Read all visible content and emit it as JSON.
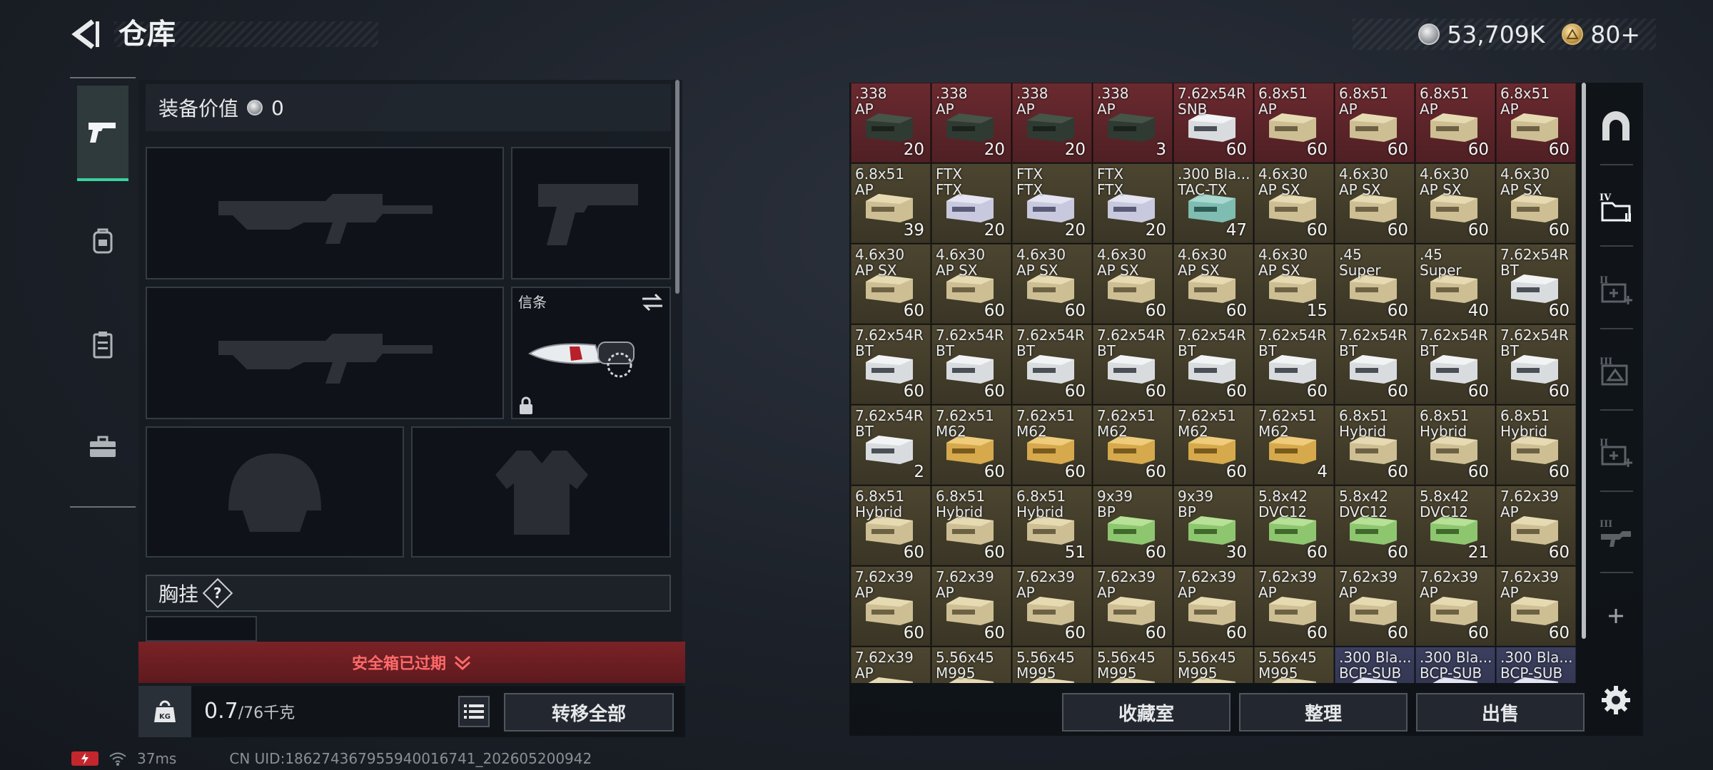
{
  "header": {
    "title": "仓库",
    "currency": [
      {
        "icon": "silver-coin-icon",
        "value": "53,709K"
      },
      {
        "icon": "gold-coin-icon",
        "value": "80+"
      }
    ]
  },
  "left_tabs": [
    {
      "icon": "pistol-icon",
      "active": true
    },
    {
      "icon": "backpack-icon",
      "active": false
    },
    {
      "icon": "clipboard-icon",
      "active": false
    },
    {
      "icon": "briefcase-icon",
      "active": false
    }
  ],
  "loadout": {
    "equip_value_label": "装备价值",
    "equip_value": "0",
    "melee_label": "信条",
    "chest_label": "胸挂",
    "help_mark": "?",
    "safebox_expired": "安全箱已过期",
    "weight_current": "0.7",
    "weight_max": "/76千克",
    "weight_icon_text": "KG",
    "transfer_all": "转移全部"
  },
  "status": {
    "ping": "37ms",
    "uid": "CN UID:1862743679559400167​41_202605200942"
  },
  "storage": {
    "items": [
      {
        "name": ".338\nAP",
        "count": "20",
        "bg": "red",
        "box": "dark"
      },
      {
        "name": ".338\nAP",
        "count": "20",
        "bg": "red",
        "box": "dark"
      },
      {
        "name": ".338\nAP",
        "count": "20",
        "bg": "red",
        "box": "dark"
      },
      {
        "name": ".338\nAP",
        "count": "3",
        "bg": "red",
        "box": "dark"
      },
      {
        "name": "7.62x54R\nSNB",
        "count": "60",
        "bg": "red",
        "box": "white"
      },
      {
        "name": "6.8x51\nAP",
        "count": "60",
        "bg": "red",
        "box": "tan"
      },
      {
        "name": "6.8x51\nAP",
        "count": "60",
        "bg": "red",
        "box": "tan"
      },
      {
        "name": "6.8x51\nAP",
        "count": "60",
        "bg": "red",
        "box": "tan"
      },
      {
        "name": "6.8x51\nAP",
        "count": "60",
        "bg": "red",
        "box": "tan"
      },
      {
        "name": "6.8x51\nAP",
        "count": "39",
        "bg": "olive",
        "box": "tan"
      },
      {
        "name": "FTX\nFTX",
        "count": "20",
        "bg": "olive",
        "box": "lavender"
      },
      {
        "name": "FTX\nFTX",
        "count": "20",
        "bg": "olive",
        "box": "lavender"
      },
      {
        "name": "FTX\nFTX",
        "count": "20",
        "bg": "olive",
        "box": "lavender"
      },
      {
        "name": ".300 Bla...\nTAC-TX",
        "count": "47",
        "bg": "olive",
        "box": "teal"
      },
      {
        "name": "4.6x30\nAP SX",
        "count": "60",
        "bg": "olive",
        "box": "tan"
      },
      {
        "name": "4.6x30\nAP SX",
        "count": "60",
        "bg": "olive",
        "box": "tan"
      },
      {
        "name": "4.6x30\nAP SX",
        "count": "60",
        "bg": "olive",
        "box": "tan"
      },
      {
        "name": "4.6x30\nAP SX",
        "count": "60",
        "bg": "olive",
        "box": "tan"
      },
      {
        "name": "4.6x30\nAP SX",
        "count": "60",
        "bg": "olive",
        "box": "tan"
      },
      {
        "name": "4.6x30\nAP SX",
        "count": "60",
        "bg": "olive",
        "box": "tan"
      },
      {
        "name": "4.6x30\nAP SX",
        "count": "60",
        "bg": "olive",
        "box": "tan"
      },
      {
        "name": "4.6x30\nAP SX",
        "count": "60",
        "bg": "olive",
        "box": "tan"
      },
      {
        "name": "4.6x30\nAP SX",
        "count": "60",
        "bg": "olive",
        "box": "tan"
      },
      {
        "name": "4.6x30\nAP SX",
        "count": "15",
        "bg": "olive",
        "box": "tan"
      },
      {
        "name": ".45\nSuper",
        "count": "60",
        "bg": "olive",
        "box": "tan"
      },
      {
        "name": ".45\nSuper",
        "count": "40",
        "bg": "olive",
        "box": "tan"
      },
      {
        "name": "7.62x54R\nBT",
        "count": "60",
        "bg": "olive",
        "box": "white"
      },
      {
        "name": "7.62x54R\nBT",
        "count": "60",
        "bg": "olive",
        "box": "white"
      },
      {
        "name": "7.62x54R\nBT",
        "count": "60",
        "bg": "olive",
        "box": "white"
      },
      {
        "name": "7.62x54R\nBT",
        "count": "60",
        "bg": "olive",
        "box": "white"
      },
      {
        "name": "7.62x54R\nBT",
        "count": "60",
        "bg": "olive",
        "box": "white"
      },
      {
        "name": "7.62x54R\nBT",
        "count": "60",
        "bg": "olive",
        "box": "white"
      },
      {
        "name": "7.62x54R\nBT",
        "count": "60",
        "bg": "olive",
        "box": "white"
      },
      {
        "name": "7.62x54R\nBT",
        "count": "60",
        "bg": "olive",
        "box": "white"
      },
      {
        "name": "7.62x54R\nBT",
        "count": "60",
        "bg": "olive",
        "box": "white"
      },
      {
        "name": "7.62x54R\nBT",
        "count": "60",
        "bg": "olive",
        "box": "white"
      },
      {
        "name": "7.62x54R\nBT",
        "count": "2",
        "bg": "olive",
        "box": "white"
      },
      {
        "name": "7.62x51\nM62",
        "count": "60",
        "bg": "olive",
        "box": "gold"
      },
      {
        "name": "7.62x51\nM62",
        "count": "60",
        "bg": "olive",
        "box": "gold"
      },
      {
        "name": "7.62x51\nM62",
        "count": "60",
        "bg": "olive",
        "box": "gold"
      },
      {
        "name": "7.62x51\nM62",
        "count": "60",
        "bg": "olive",
        "box": "gold"
      },
      {
        "name": "7.62x51\nM62",
        "count": "4",
        "bg": "olive",
        "box": "gold"
      },
      {
        "name": "6.8x51\nHybrid",
        "count": "60",
        "bg": "olive",
        "box": "tan"
      },
      {
        "name": "6.8x51\nHybrid",
        "count": "60",
        "bg": "olive",
        "box": "tan"
      },
      {
        "name": "6.8x51\nHybrid",
        "count": "60",
        "bg": "olive",
        "box": "tan"
      },
      {
        "name": "6.8x51\nHybrid",
        "count": "60",
        "bg": "olive",
        "box": "tan"
      },
      {
        "name": "6.8x51\nHybrid",
        "count": "60",
        "bg": "olive",
        "box": "tan"
      },
      {
        "name": "6.8x51\nHybrid",
        "count": "51",
        "bg": "olive",
        "box": "tan"
      },
      {
        "name": "9x39\nBP",
        "count": "60",
        "bg": "olive",
        "box": "green"
      },
      {
        "name": "9x39\nBP",
        "count": "30",
        "bg": "olive",
        "box": "green"
      },
      {
        "name": "5.8x42\nDVC12",
        "count": "60",
        "bg": "olive",
        "box": "green"
      },
      {
        "name": "5.8x42\nDVC12",
        "count": "60",
        "bg": "olive",
        "box": "green"
      },
      {
        "name": "5.8x42\nDVC12",
        "count": "21",
        "bg": "olive",
        "box": "green"
      },
      {
        "name": "7.62x39\nAP",
        "count": "60",
        "bg": "olive",
        "box": "tan"
      },
      {
        "name": "7.62x39\nAP",
        "count": "60",
        "bg": "olive",
        "box": "tan"
      },
      {
        "name": "7.62x39\nAP",
        "count": "60",
        "bg": "olive",
        "box": "tan"
      },
      {
        "name": "7.62x39\nAP",
        "count": "60",
        "bg": "olive",
        "box": "tan"
      },
      {
        "name": "7.62x39\nAP",
        "count": "60",
        "bg": "olive",
        "box": "tan"
      },
      {
        "name": "7.62x39\nAP",
        "count": "60",
        "bg": "olive",
        "box": "tan"
      },
      {
        "name": "7.62x39\nAP",
        "count": "60",
        "bg": "olive",
        "box": "tan"
      },
      {
        "name": "7.62x39\nAP",
        "count": "60",
        "bg": "olive",
        "box": "tan"
      },
      {
        "name": "7.62x39\nAP",
        "count": "60",
        "bg": "olive",
        "box": "tan"
      },
      {
        "name": "7.62x39\nAP",
        "count": "60",
        "bg": "olive",
        "box": "tan"
      },
      {
        "name": "7.62x39\nAP",
        "count": "",
        "bg": "olive",
        "box": "tan"
      },
      {
        "name": "5.56x45\nM995",
        "count": "",
        "bg": "olive",
        "box": "tan"
      },
      {
        "name": "5.56x45\nM995",
        "count": "",
        "bg": "olive",
        "box": "tan"
      },
      {
        "name": "5.56x45\nM995",
        "count": "",
        "bg": "olive",
        "box": "tan"
      },
      {
        "name": "5.56x45\nM995",
        "count": "",
        "bg": "olive",
        "box": "tan"
      },
      {
        "name": "5.56x45\nM995",
        "count": "",
        "bg": "olive",
        "box": "tan"
      },
      {
        "name": ".300 Bla...\nBCP-SUB",
        "count": "",
        "bg": "blue",
        "box": "lavender"
      },
      {
        "name": ".300 Bla...\nBCP-SUB",
        "count": "",
        "bg": "blue",
        "box": "lavender"
      },
      {
        "name": ".300 Bla...\nBCP-SUB",
        "count": "",
        "bg": "blue",
        "box": "lavender"
      }
    ],
    "buttons": {
      "collection": "收藏室",
      "organize": "整理",
      "sell": "出售"
    }
  },
  "right_rail": [
    "arch-shelter-icon",
    "folder-IV-icon",
    "medkit-II-icon",
    "gear-III-icon",
    "medkit-II-b-icon",
    "rifle-III-icon",
    "plus-icon",
    "settings-gear-icon"
  ],
  "colors": {
    "accent_green": "#38d39b",
    "alert_red": "#ff6a6a",
    "tier_red": "#6a2a2f",
    "tier_olive": "#4c4530",
    "tier_blue": "#3c3f5e"
  }
}
